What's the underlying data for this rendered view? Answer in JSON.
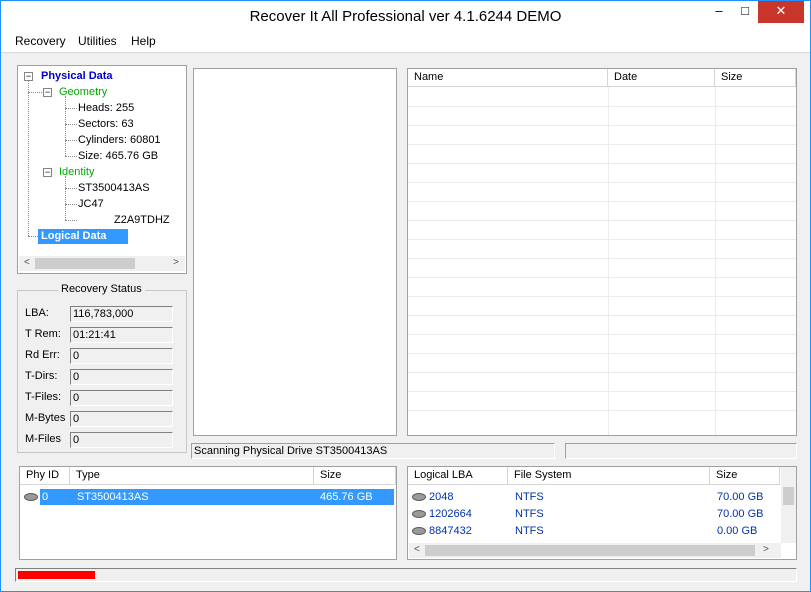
{
  "window": {
    "title": "Recover It All Professional ver 4.1.6244 DEMO",
    "controls": {
      "minimize": "–",
      "maximize": "□",
      "close": "✕"
    }
  },
  "menu": [
    "Recovery",
    "Utilities",
    "Help"
  ],
  "tree": {
    "physical": "Physical Data",
    "geometry": "Geometry",
    "geometry_items": [
      "Heads: 255",
      "Sectors: 63",
      "Cylinders: 60801",
      "Size: 465.76 GB"
    ],
    "identity": "Identity",
    "identity_items": [
      "ST3500413AS",
      "JC47",
      "Z2A9TDHZ"
    ],
    "logical": "Logical Data",
    "colors": {
      "physical": "#0000cc",
      "sub": "#00aa00",
      "selected_bg": "#3399ff"
    }
  },
  "recovery_status": {
    "title": "Recovery Status",
    "fields": [
      {
        "label": "LBA:",
        "value": "116,783,000"
      },
      {
        "label": "T Rem:",
        "value": "01:21:41"
      },
      {
        "label": "Rd Err:",
        "value": "0"
      },
      {
        "label": "T-Dirs:",
        "value": "0"
      },
      {
        "label": "T-Files:",
        "value": "0"
      },
      {
        "label": "M-Bytes",
        "value": "0"
      },
      {
        "label": "M-Files",
        "value": "0"
      }
    ]
  },
  "files_table": {
    "columns": [
      "Name",
      "Date",
      "Size"
    ]
  },
  "status_text": "Scanning Physical Drive ST3500413AS",
  "physical_table": {
    "columns": [
      "Phy ID",
      "Type",
      "Size"
    ],
    "rows": [
      {
        "id": "0",
        "type": "ST3500413AS",
        "size": "465.76 GB"
      }
    ]
  },
  "logical_table": {
    "columns": [
      "Logical LBA",
      "File System",
      "Size"
    ],
    "rows": [
      {
        "lba": "2048",
        "fs": "NTFS",
        "size": "70.00 GB"
      },
      {
        "lba": "1202664",
        "fs": "NTFS",
        "size": "70.00 GB"
      },
      {
        "lba": "8847432",
        "fs": "NTFS",
        "size": "0.00 GB"
      }
    ]
  },
  "progress": {
    "fraction": 0.1,
    "color": "#ff0000"
  }
}
